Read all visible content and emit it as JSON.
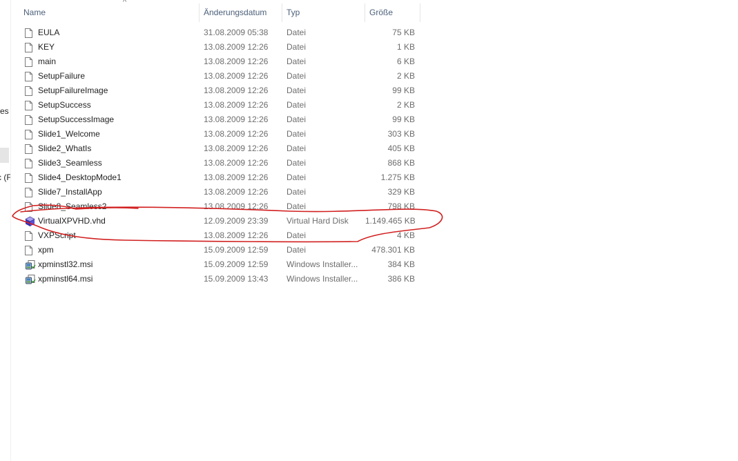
{
  "nav": {
    "fragment_1": "es",
    "fragment_2": "c (F"
  },
  "columns": {
    "name": "Name",
    "date": "Änderungsdatum",
    "type": "Typ",
    "size": "Größe"
  },
  "sort_indicator": "^",
  "colors": {
    "annotation": "#d21f1f",
    "header_text": "#4c607a",
    "meta_text": "#6d6d6d"
  },
  "files": [
    {
      "icon": "generic-file-icon",
      "name": "EULA",
      "date": "31.08.2009 05:38",
      "type": "Datei",
      "size": "75 KB"
    },
    {
      "icon": "generic-file-icon",
      "name": "KEY",
      "date": "13.08.2009 12:26",
      "type": "Datei",
      "size": "1 KB"
    },
    {
      "icon": "generic-file-icon",
      "name": "main",
      "date": "13.08.2009 12:26",
      "type": "Datei",
      "size": "6 KB"
    },
    {
      "icon": "generic-file-icon",
      "name": "SetupFailure",
      "date": "13.08.2009 12:26",
      "type": "Datei",
      "size": "2 KB"
    },
    {
      "icon": "generic-file-icon",
      "name": "SetupFailureImage",
      "date": "13.08.2009 12:26",
      "type": "Datei",
      "size": "99 KB"
    },
    {
      "icon": "generic-file-icon",
      "name": "SetupSuccess",
      "date": "13.08.2009 12:26",
      "type": "Datei",
      "size": "2 KB"
    },
    {
      "icon": "generic-file-icon",
      "name": "SetupSuccessImage",
      "date": "13.08.2009 12:26",
      "type": "Datei",
      "size": "99 KB"
    },
    {
      "icon": "generic-file-icon",
      "name": "Slide1_Welcome",
      "date": "13.08.2009 12:26",
      "type": "Datei",
      "size": "303 KB"
    },
    {
      "icon": "generic-file-icon",
      "name": "Slide2_WhatIs",
      "date": "13.08.2009 12:26",
      "type": "Datei",
      "size": "405 KB"
    },
    {
      "icon": "generic-file-icon",
      "name": "Slide3_Seamless",
      "date": "13.08.2009 12:26",
      "type": "Datei",
      "size": "868 KB"
    },
    {
      "icon": "generic-file-icon",
      "name": "Slide4_DesktopMode1",
      "date": "13.08.2009 12:26",
      "type": "Datei",
      "size": "1.275 KB"
    },
    {
      "icon": "generic-file-icon",
      "name": "Slide7_InstallApp",
      "date": "13.08.2009 12:26",
      "type": "Datei",
      "size": "329 KB"
    },
    {
      "icon": "generic-file-icon",
      "name": "Slide8_Seamless2",
      "date": "13.08.2009 12:26",
      "type": "Datei",
      "size": "798 KB"
    },
    {
      "icon": "virtual-disk-icon",
      "name": "VirtualXPVHD.vhd",
      "date": "12.09.2009 23:39",
      "type": "Virtual Hard Disk",
      "size": "1.149.465 KB"
    },
    {
      "icon": "generic-file-icon",
      "name": "VXPScript",
      "date": "13.08.2009 12:26",
      "type": "Datei",
      "size": "4 KB"
    },
    {
      "icon": "generic-file-icon",
      "name": "xpm",
      "date": "15.09.2009 12:59",
      "type": "Datei",
      "size": "478.301 KB"
    },
    {
      "icon": "msi-installer-icon",
      "name": "xpminstl32.msi",
      "date": "15.09.2009 12:59",
      "type": "Windows Installer...",
      "size": "384 KB"
    },
    {
      "icon": "msi-installer-icon",
      "name": "xpminstl64.msi",
      "date": "15.09.2009 13:43",
      "type": "Windows Installer...",
      "size": "386 KB"
    }
  ]
}
